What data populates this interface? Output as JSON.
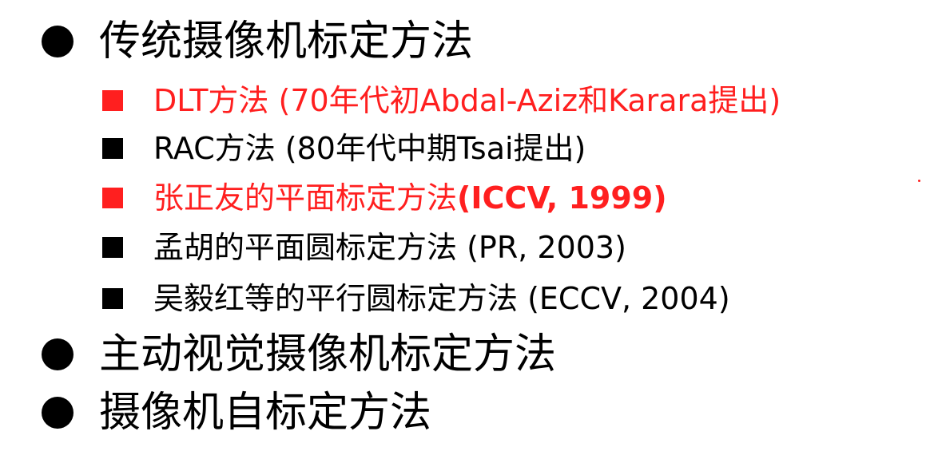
{
  "items": [
    {
      "text": "传统摄像机标定方法"
    },
    {
      "text": "DLT方法 (70年代初Abdal-Aziz和Karara提出)"
    },
    {
      "text": "RAC方法 (80年代中期Tsai提出)"
    },
    {
      "text": "张正友的平面标定方法 ",
      "suffix": "(ICCV, 1999)"
    },
    {
      "text": "孟胡的平面圆标定方法 (PR, 2003)"
    },
    {
      "text": "吴毅红等的平行圆标定方法 (ECCV, 2004)"
    },
    {
      "text": "主动视觉摄像机标定方法"
    },
    {
      "text": "摄像机自标定方法"
    }
  ],
  "colors": {
    "highlight": "#ff1f1f",
    "text": "#000000"
  }
}
